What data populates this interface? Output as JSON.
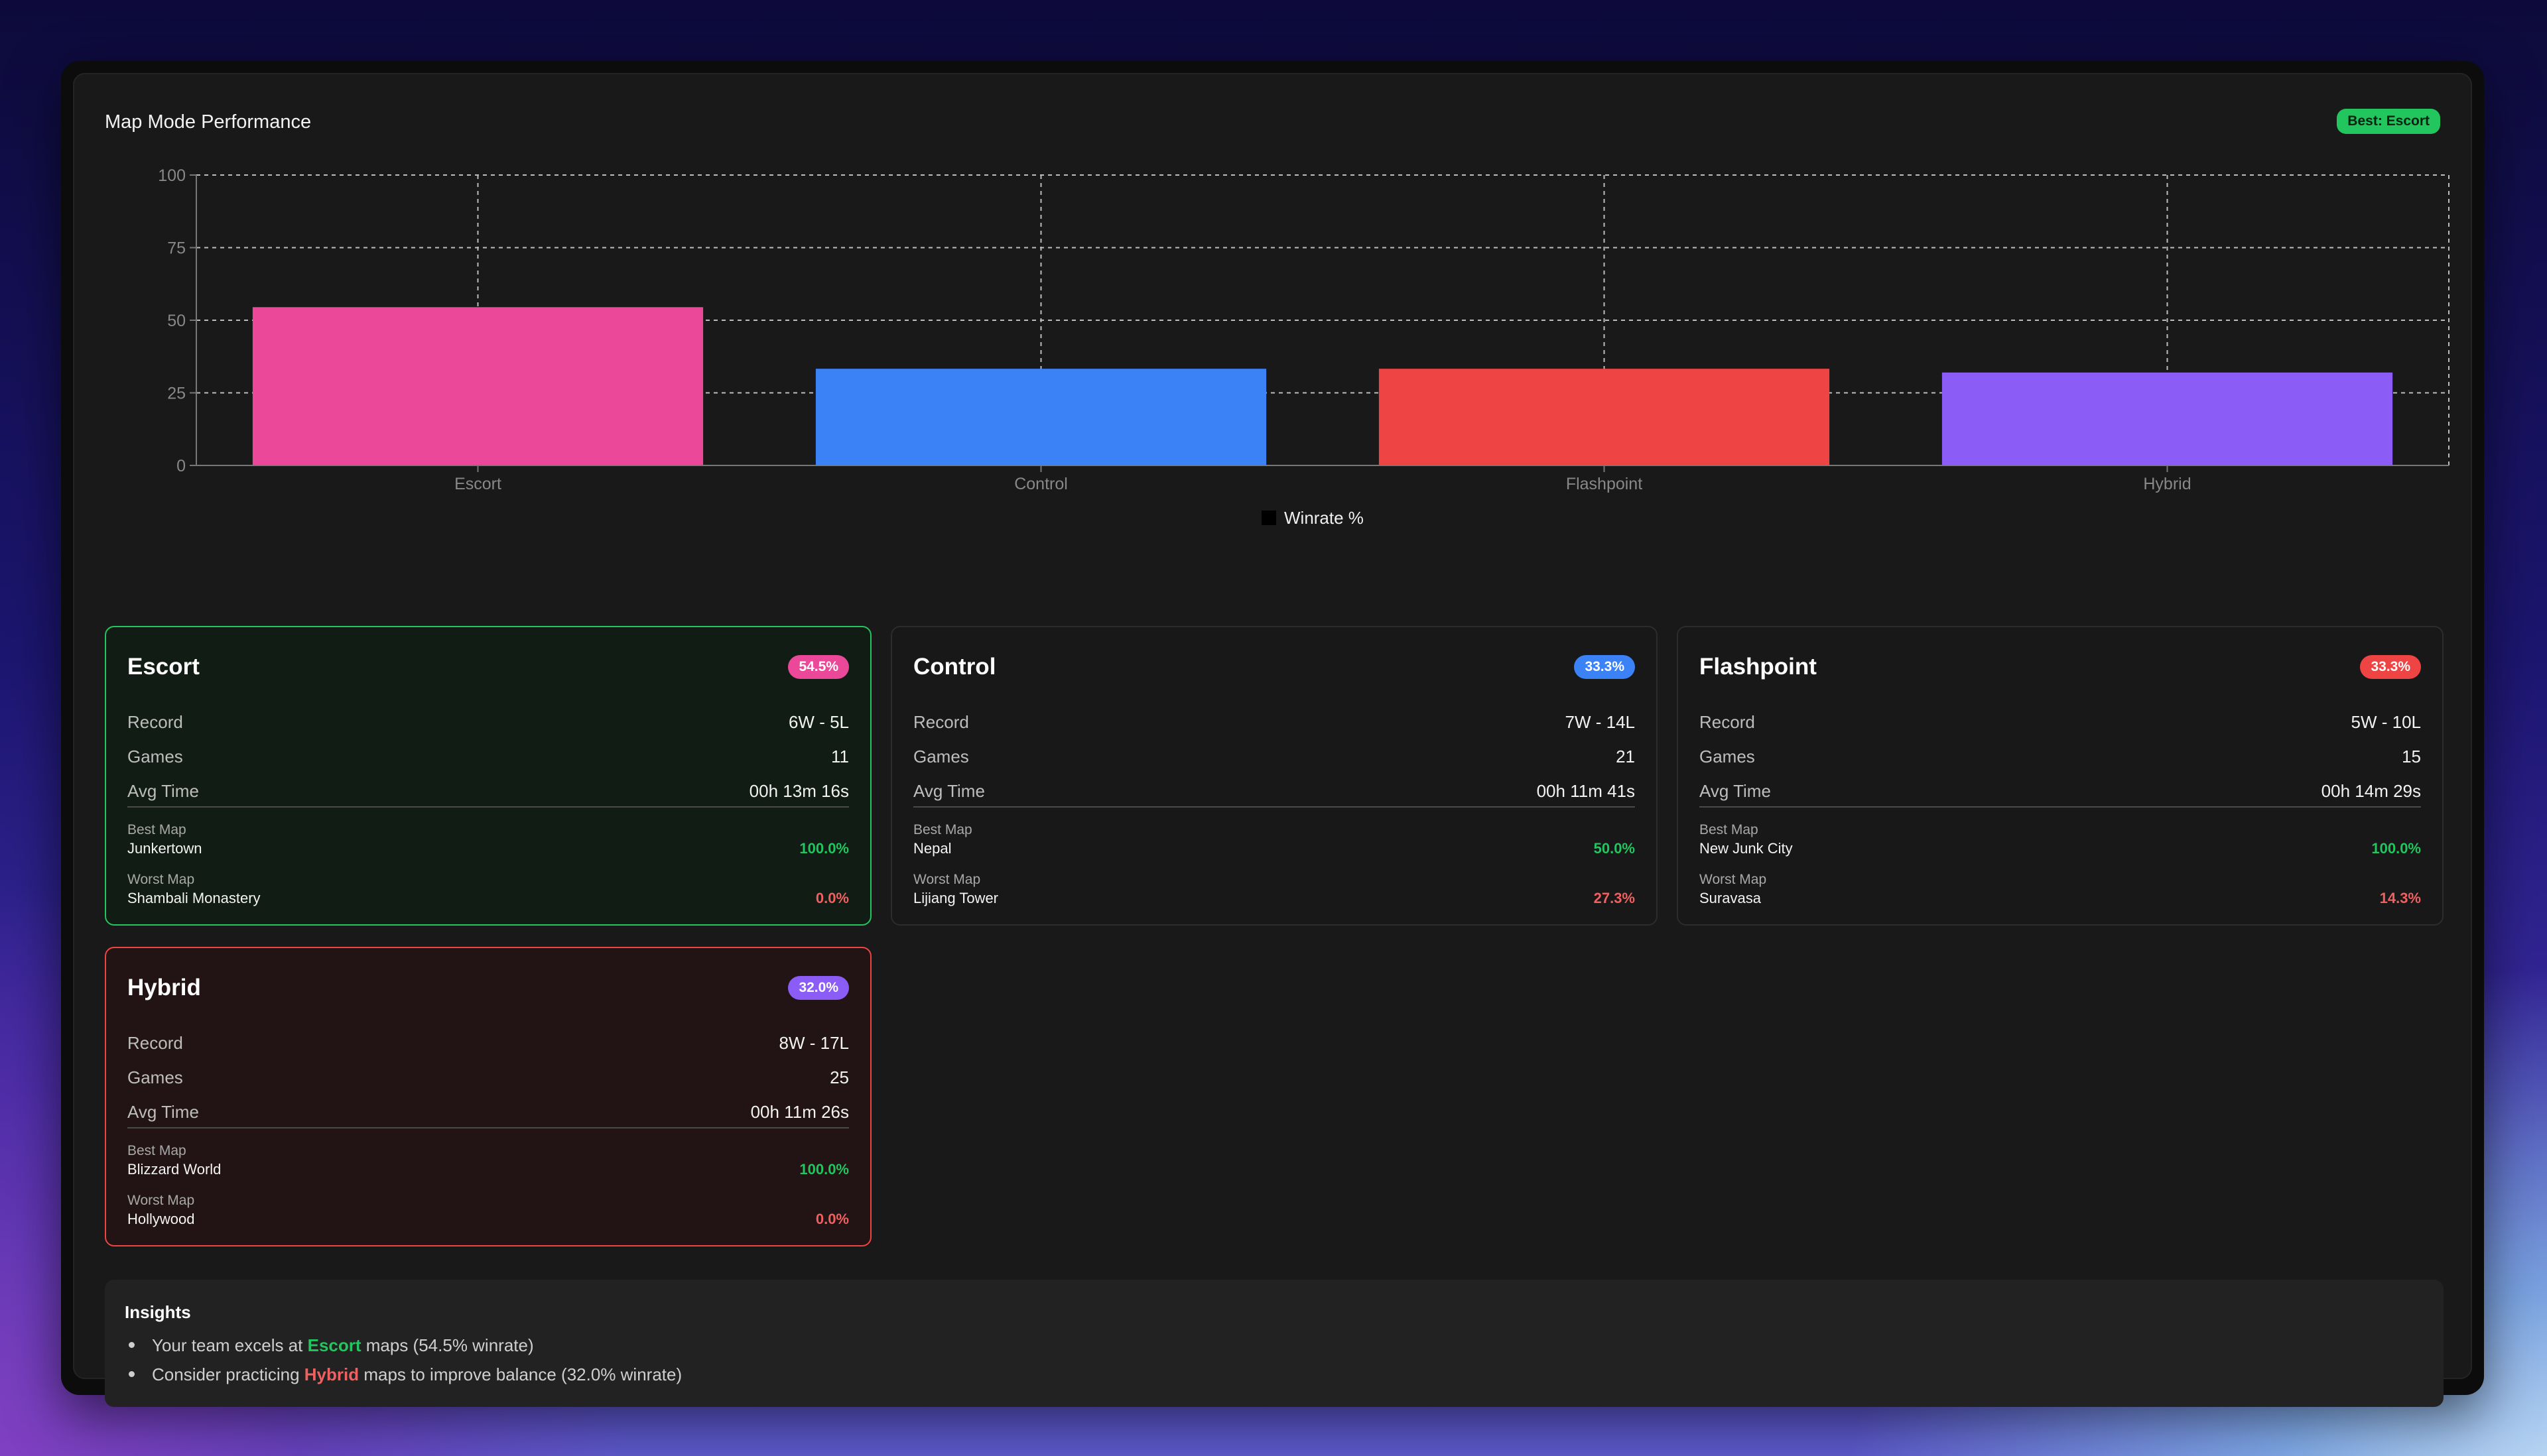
{
  "panel": {
    "title": "Map Mode Performance",
    "best_badge": "Best: Escort"
  },
  "chart_data": {
    "type": "bar",
    "categories": [
      "Escort",
      "Control",
      "Flashpoint",
      "Hybrid"
    ],
    "series": [
      {
        "name": "Winrate %",
        "values": [
          54.5,
          33.3,
          33.3,
          32.0
        ],
        "colors": [
          "#ec4899",
          "#3b82f6",
          "#ef4444",
          "#8b5cf6"
        ]
      }
    ],
    "ylim": [
      0,
      100
    ],
    "yticks": [
      0,
      25,
      50,
      75,
      100
    ],
    "grid": true,
    "legend": "bottom",
    "legend_color": "#000000"
  },
  "cards": [
    {
      "name": "Escort",
      "pill": "54.5%",
      "color": "#ec4899",
      "state": "good",
      "record_label": "Record",
      "record": "6W - 5L",
      "games_label": "Games",
      "games": "11",
      "time_label": "Avg Time",
      "time": "00h 13m 16s",
      "best_label": "Best Map",
      "best_map": "Junkertown",
      "best_pct": "100.0%",
      "worst_label": "Worst Map",
      "worst_map": "Shambali Monastery",
      "worst_pct": "0.0%"
    },
    {
      "name": "Control",
      "pill": "33.3%",
      "color": "#3b82f6",
      "state": "neutral",
      "record_label": "Record",
      "record": "7W - 14L",
      "games_label": "Games",
      "games": "21",
      "time_label": "Avg Time",
      "time": "00h 11m 41s",
      "best_label": "Best Map",
      "best_map": "Nepal",
      "best_pct": "50.0%",
      "worst_label": "Worst Map",
      "worst_map": "Lijiang Tower",
      "worst_pct": "27.3%"
    },
    {
      "name": "Flashpoint",
      "pill": "33.3%",
      "color": "#ef4444",
      "state": "neutral",
      "record_label": "Record",
      "record": "5W - 10L",
      "games_label": "Games",
      "games": "15",
      "time_label": "Avg Time",
      "time": "00h 14m 29s",
      "best_label": "Best Map",
      "best_map": "New Junk City",
      "best_pct": "100.0%",
      "worst_label": "Worst Map",
      "worst_map": "Suravasa",
      "worst_pct": "14.3%"
    },
    {
      "name": "Hybrid",
      "pill": "32.0%",
      "color": "#8b5cf6",
      "state": "bad",
      "record_label": "Record",
      "record": "8W - 17L",
      "games_label": "Games",
      "games": "25",
      "time_label": "Avg Time",
      "time": "00h 11m 26s",
      "best_label": "Best Map",
      "best_map": "Blizzard World",
      "best_pct": "100.0%",
      "worst_label": "Worst Map",
      "worst_map": "Hollywood",
      "worst_pct": "0.0%"
    }
  ],
  "insights": {
    "title": "Insights",
    "line1_pre": "Your team excels at ",
    "line1_hl": "Escort",
    "line1_post": " maps (54.5% winrate)",
    "line2_pre": "Consider practicing ",
    "line2_hl": "Hybrid",
    "line2_post": " maps to improve balance (32.0% winrate)"
  }
}
